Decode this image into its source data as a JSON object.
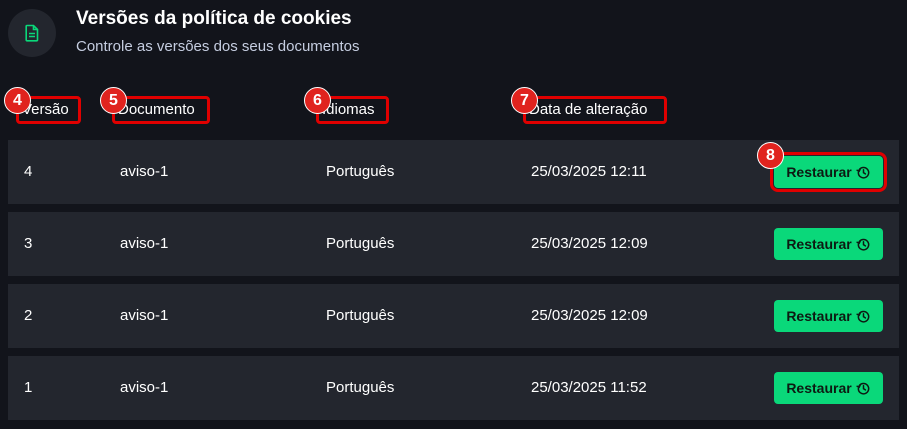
{
  "header": {
    "icon": "document-icon",
    "title": "Versões da política de cookies",
    "subtitle": "Controle as versões dos seus documentos"
  },
  "columns": [
    {
      "label": "Versão",
      "badge": "4"
    },
    {
      "label": "Documento",
      "badge": "5"
    },
    {
      "label": "Idiomas",
      "badge": "6"
    },
    {
      "label": "Data de alteração",
      "badge": "7"
    }
  ],
  "action_badge": "8",
  "rows": [
    {
      "version": "4",
      "document": "aviso-1",
      "language": "Português",
      "date": "25/03/2025 12:11",
      "action": "Restaurar"
    },
    {
      "version": "3",
      "document": "aviso-1",
      "language": "Português",
      "date": "25/03/2025 12:09",
      "action": "Restaurar"
    },
    {
      "version": "2",
      "document": "aviso-1",
      "language": "Português",
      "date": "25/03/2025 12:09",
      "action": "Restaurar"
    },
    {
      "version": "1",
      "document": "aviso-1",
      "language": "Português",
      "date": "25/03/2025 11:52",
      "action": "Restaurar"
    }
  ],
  "colors": {
    "background": "#12141b",
    "row": "#23262e",
    "accent": "#0ad87a",
    "highlight": "#e00000"
  }
}
